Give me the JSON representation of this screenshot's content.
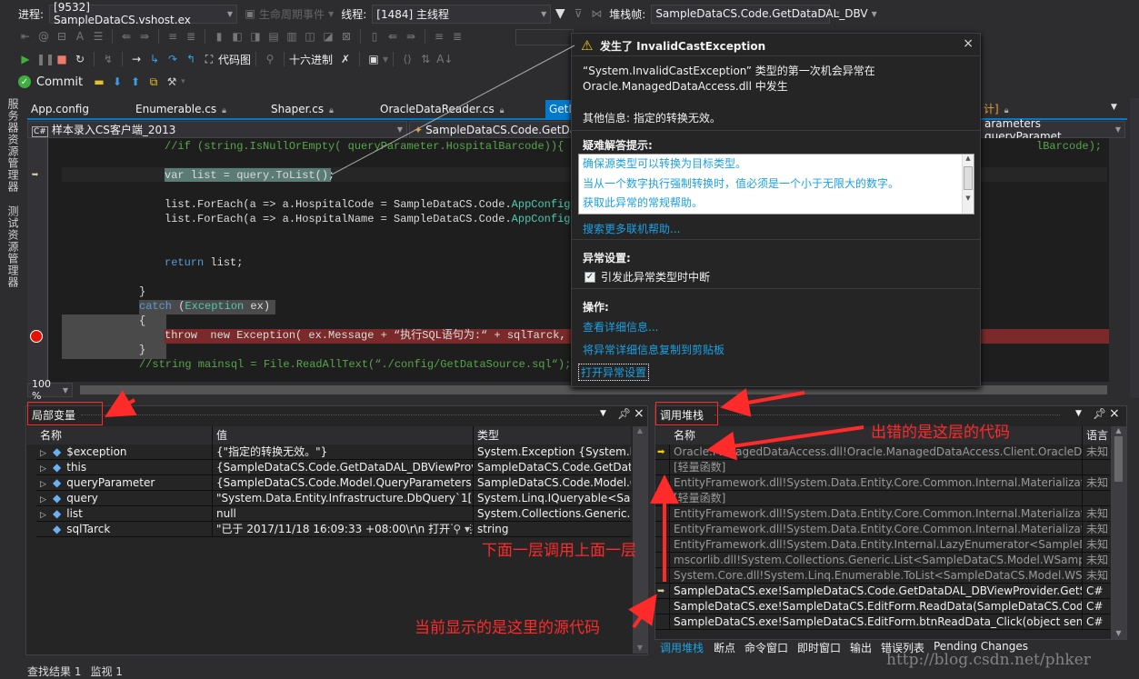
{
  "debug_location": {
    "process_label": "进程:",
    "process_value": "[9532] SampleDataCS.vshost.ex",
    "lifecycle_label": "生命周期事件",
    "thread_label": "线程:",
    "thread_value": "[1484] 主线程",
    "stackframe_label": "堆栈帧:",
    "stackframe_value": "SampleDataCS.Code.GetDataDAL_DBV"
  },
  "debug_toolbar": {
    "code_map": "代码图",
    "hex": "十六进制"
  },
  "team_toolbar": {
    "commit": "Commit"
  },
  "left_strip": [
    "服务器资源管理器",
    "测试资源管理器"
  ],
  "tabs": [
    {
      "label": "App.config",
      "locked": false
    },
    {
      "label": "Enumerable.cs",
      "locked": true
    },
    {
      "label": "Shaper.cs",
      "locked": true
    },
    {
      "label": "OracleDataReader.cs",
      "locked": true
    },
    {
      "label": "GetD",
      "active": true
    },
    {
      "label": "计]",
      "locked": true
    }
  ],
  "nav": {
    "project": "样本录入CS客户端_2013",
    "class": "SampleDataCS.Code.GetDataD",
    "member": "arameters queryParamet"
  },
  "code_lines": [
    [
      [
        "//if (string.IsNullOrEmpty( queryParameter.HospitalBarcode)){ qu",
        "cm"
      ]
    ],
    [
      [
        "var list = query.ToList();",
        ""
      ]
    ],
    [
      [
        "list.ForEach(a => a.HospitalCode = SampleDataCS.Code.",
        ""
      ],
      [
        "AppConfigs.",
        "ty"
      ]
    ],
    [
      [
        "list.ForEach(a => a.HospitalName = SampleDataCS.Code.",
        ""
      ],
      [
        "AppConfigs.",
        "ty"
      ]
    ],
    [
      [
        "return",
        "kw"
      ],
      [
        " list;",
        ""
      ]
    ],
    [
      [
        "}",
        ""
      ]
    ],
    [
      [
        "catch",
        "kw"
      ],
      [
        " (",
        ""
      ],
      [
        "Exception",
        "ty"
      ],
      [
        " ex)",
        ""
      ]
    ],
    [
      [
        "{",
        ""
      ]
    ],
    [
      [
        "throw  new Exception( ex.Message + “执行SQL语句为:“ + sqlTarck,",
        ""
      ]
    ],
    [
      [
        "}",
        ""
      ]
    ],
    [
      [
        "//string mainsql = File.ReadAllText(“./config/GetDataSource.sql“);",
        "cm"
      ]
    ]
  ],
  "code_right_fragment": "lBarcode); }",
  "zoom_level": "100 %",
  "exception": {
    "title": "发生了 InvalidCastException",
    "line1": "“System.InvalidCastException” 类型的第一次机会异常在",
    "line2": "Oracle.ManagedDataAccess.dll 中发生",
    "other_info": "其他信息: 指定的转换无效。",
    "tips_header": "疑难解答提示:",
    "tips": [
      "确保源类型可以转换为目标类型。",
      "当从一个数字执行强制转换时，值必须是一个小于无限大的数字。",
      "获取此异常的常规帮助。"
    ],
    "search_more": "搜索更多联机帮助...",
    "settings_header": "异常设置:",
    "break_checkbox": "引发此异常类型时中断",
    "break_checked": true,
    "actions_header": "操作:",
    "view_details": "查看详细信息...",
    "copy_details": "将异常详细信息复制到剪贴板",
    "open_settings": "打开异常设置"
  },
  "locals": {
    "title": "局部变量",
    "columns": [
      "名称",
      "值",
      "类型"
    ],
    "rows": [
      {
        "name": "$exception",
        "value": "{\"指定的转换无效。\"}",
        "type": "System.Exception {System.InvalidCastException}",
        "expandable": true
      },
      {
        "name": "this",
        "value": "{SampleDataCS.Code.GetDataDAL_DBViewProvider}",
        "type": "SampleDataCS.Code.GetDataDAL_DBViewProvider",
        "expandable": true
      },
      {
        "name": "queryParameter",
        "value": "{SampleDataCS.Code.Model.QueryParameters}",
        "type": "SampleDataCS.Code.Model.QueryParameters",
        "expandable": true
      },
      {
        "name": "query",
        "value": "\"System.Data.Entity.Infrastructure.DbQuery`1[SampleDataCS",
        "type": "System.Linq.IQueryable<SampleDataCS",
        "expandable": true
      },
      {
        "name": "list",
        "value": "null",
        "type": "System.Collections.Generic.List<",
        "expandable": true
      },
      {
        "name": "sqlTarck",
        "value": "\"已于 2017/11/18 16:09:33 +08:00\\r\\n 打开了连接",
        "type": "string",
        "expandable": false
      }
    ]
  },
  "callstack": {
    "title": "调用堆栈",
    "columns": [
      "名称",
      "语言"
    ],
    "rows": [
      {
        "name": "Oracle.ManagedDataAccess.dll!Oracle.ManagedDataAccess.Client.OracleDataReader.",
        "lang": "未知",
        "marker": "current",
        "dim": true
      },
      {
        "name": "[轻量函数]",
        "lang": "",
        "dim": true
      },
      {
        "name": "EntityFramework.dll!System.Data.Entity.Core.Common.Internal.Materialization.Shaper",
        "lang": "未知",
        "dim": true
      },
      {
        "name": "[轻量函数]",
        "lang": "",
        "dim": true
      },
      {
        "name": "EntityFramework.dll!System.Data.Entity.Core.Common.Internal.Materialization.Coordinator",
        "lang": "未知",
        "dim": true
      },
      {
        "name": "EntityFramework.dll!System.Data.Entity.Core.Common.Internal.Materialization.Shaper",
        "lang": "未知",
        "dim": true
      },
      {
        "name": "EntityFramework.dll!System.Data.Entity.Internal.LazyEnumerator<SampleDataCS.Model",
        "lang": "未知",
        "dim": true
      },
      {
        "name": "mscorlib.dll!System.Collections.Generic.List<SampleDataCS.Model.WSampleInputOrder",
        "lang": "未知",
        "dim": true
      },
      {
        "name": "System.Core.dll!System.Linq.Enumerable.ToList<SampleDataCS.Model.WSampleInput",
        "lang": "未知",
        "dim": true
      },
      {
        "name": "SampleDataCS.exe!SampleDataCS.Code.GetDataDAL_DBViewProvider.GetSampleData",
        "lang": "C#",
        "marker": "source",
        "dim": false
      },
      {
        "name": "SampleDataCS.exe!SampleDataCS.EditForm.ReadData(SampleDataCS.Code.Model.Query",
        "lang": "C#",
        "dim": false
      },
      {
        "name": "SampleDataCS.exe!SampleDataCS.EditForm.btnReadData_Click(object sender, System",
        "lang": "C#",
        "dim": false
      }
    ]
  },
  "bottom_tabs": [
    "调用堆栈",
    "断点",
    "命令窗口",
    "即时窗口",
    "输出",
    "错误列表",
    "Pending Changes"
  ],
  "status_tabs": [
    "查找结果 1",
    "监视 1"
  ],
  "annotations": {
    "error_layer": "出错的是这层的代码",
    "call_up": "下面一层调用上面一层",
    "current_source": "当前显示的是这里的源代码"
  },
  "watermark": "http://blog.csdn.net/phker",
  "colors": {
    "accent": "#007acc",
    "annotation": "#ff2a2a",
    "breakpoint": "#e51400",
    "throw_line": "#7a2a2a"
  }
}
